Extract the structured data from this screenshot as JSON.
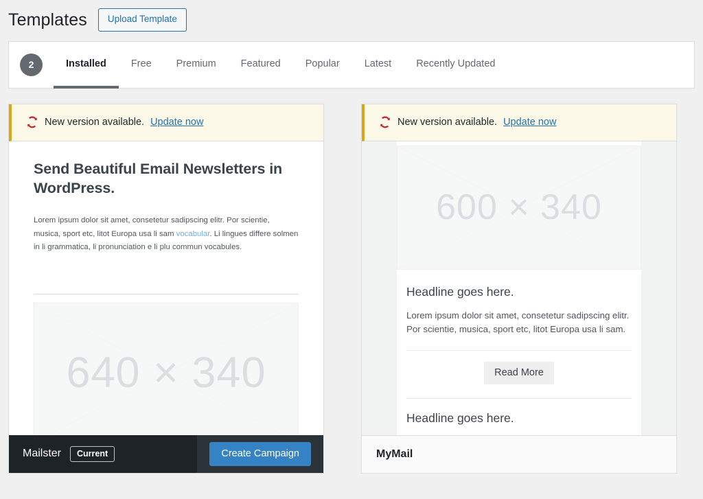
{
  "header": {
    "title": "Templates",
    "upload_button": "Upload Template"
  },
  "tabbar": {
    "count": "2",
    "tabs": [
      {
        "label": "Installed",
        "active": true
      },
      {
        "label": "Free",
        "active": false
      },
      {
        "label": "Premium",
        "active": false
      },
      {
        "label": "Featured",
        "active": false
      },
      {
        "label": "Popular",
        "active": false
      },
      {
        "label": "Latest",
        "active": false
      },
      {
        "label": "Recently Updated",
        "active": false
      }
    ]
  },
  "colors": {
    "page_bg": "#f0f0f1",
    "notice_bg": "#fcf9e8",
    "notice_accent": "#dba617",
    "notice_icon": "#c3282f",
    "link": "#2271b1",
    "primary_button": "#3582c4",
    "footer_dark": "#1d2327",
    "footer_dark_alt": "#2c3338",
    "badge_bg": "#646970",
    "placeholder_text": "#dcdde1"
  },
  "cards": [
    {
      "notice": {
        "icon": "update-icon",
        "text": "New version available.",
        "link": "Update now"
      },
      "preview": {
        "heading": "Send Beautiful Email Newsletters in WordPress.",
        "body_part1": "Lorem ipsum dolor sit amet, consetetur sadipscing elitr. Por scientie, musica, sport etc, litot Europa usa li sam ",
        "body_link": "vocabular",
        "body_part2": ". Li lingues differe solmen in li grammatica, li pronunciation e li plu commun vocabules.",
        "placeholder_label": "640 × 340"
      },
      "footer": {
        "title": "Mailster",
        "badge": "Current",
        "action_button": "Create Campaign"
      }
    },
    {
      "notice": {
        "icon": "update-icon",
        "text": "New version available.",
        "link": "Update now"
      },
      "preview": {
        "placeholder_label": "600 × 340",
        "heading": "Headline goes here.",
        "body": "Lorem ipsum dolor sit amet, consetetur sadipscing elitr. Por scientie, musica, sport etc, litot Europa usa li sam.",
        "read_more": "Read More",
        "heading_cut": "Headline goes here."
      },
      "footer": {
        "title": "MyMail"
      }
    }
  ]
}
